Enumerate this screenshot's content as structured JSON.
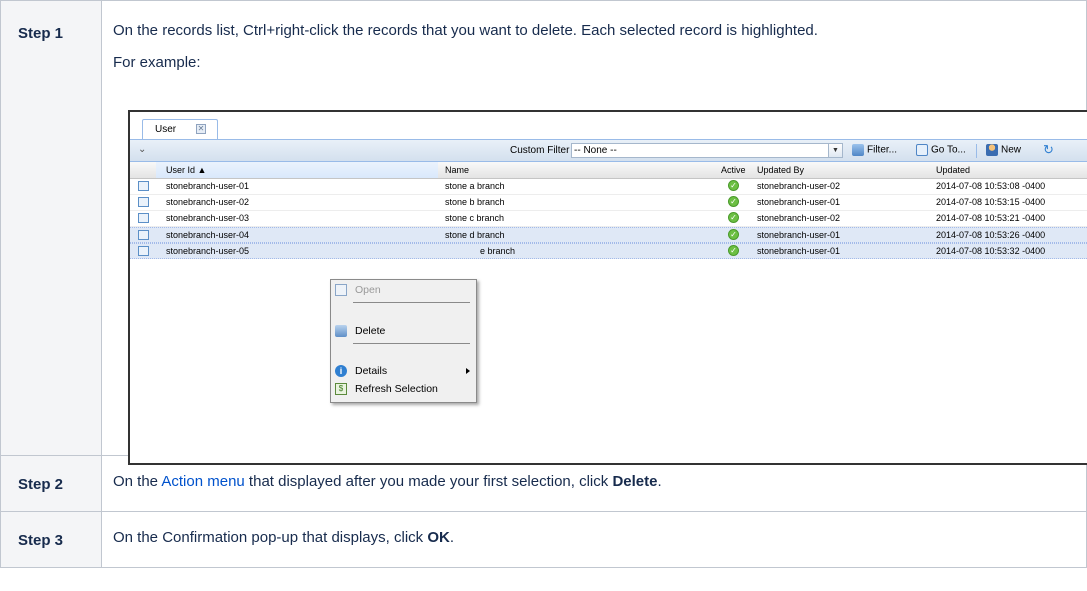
{
  "steps": [
    {
      "label": "Step 1",
      "text": "On the records list, Ctrl+right-click the records that you want to delete. Each selected record is highlighted.",
      "example": "For example:"
    },
    {
      "label": "Step 2",
      "pre": "On the ",
      "link": "Action menu",
      "mid": " that displayed after you made your first selection, click ",
      "bold": "Delete",
      "post": "."
    },
    {
      "label": "Step 3",
      "pre": "On the Confirmation pop-up that displays, click ",
      "bold": "OK",
      "post": "."
    }
  ],
  "app": {
    "tab_label": "User",
    "toolbar": {
      "custom_filter_label": "Custom Filter",
      "custom_filter_value": "-- None --",
      "filter_label": "Filter...",
      "goto_label": "Go To...",
      "new_label": "New"
    },
    "columns": [
      "User Id",
      "Name",
      "Active",
      "Updated By",
      "Updated"
    ],
    "rows": [
      {
        "user_id": "stonebranch-user-01",
        "name": "stone a branch",
        "updated_by": "stonebranch-user-02",
        "updated": "2014-07-08 10:53:08 -0400",
        "selected": false
      },
      {
        "user_id": "stonebranch-user-02",
        "name": "stone b branch",
        "updated_by": "stonebranch-user-01",
        "updated": "2014-07-08 10:53:15 -0400",
        "selected": false
      },
      {
        "user_id": "stonebranch-user-03",
        "name": "stone c branch",
        "updated_by": "stonebranch-user-02",
        "updated": "2014-07-08 10:53:21 -0400",
        "selected": false
      },
      {
        "user_id": "stonebranch-user-04",
        "name": "stone d branch",
        "updated_by": "stonebranch-user-01",
        "updated": "2014-07-08 10:53:26 -0400",
        "selected": true
      },
      {
        "user_id": "stonebranch-user-05",
        "name": "e branch",
        "updated_by": "stonebranch-user-01",
        "updated": "2014-07-08 10:53:32 -0400",
        "selected": true
      }
    ],
    "context_menu": {
      "open": "Open",
      "delete": "Delete",
      "details": "Details",
      "refresh": "Refresh Selection"
    }
  },
  "colors": {
    "selected_row": "#dfe8f6",
    "link": "#0052cc",
    "active_green": "#6cbf43"
  }
}
